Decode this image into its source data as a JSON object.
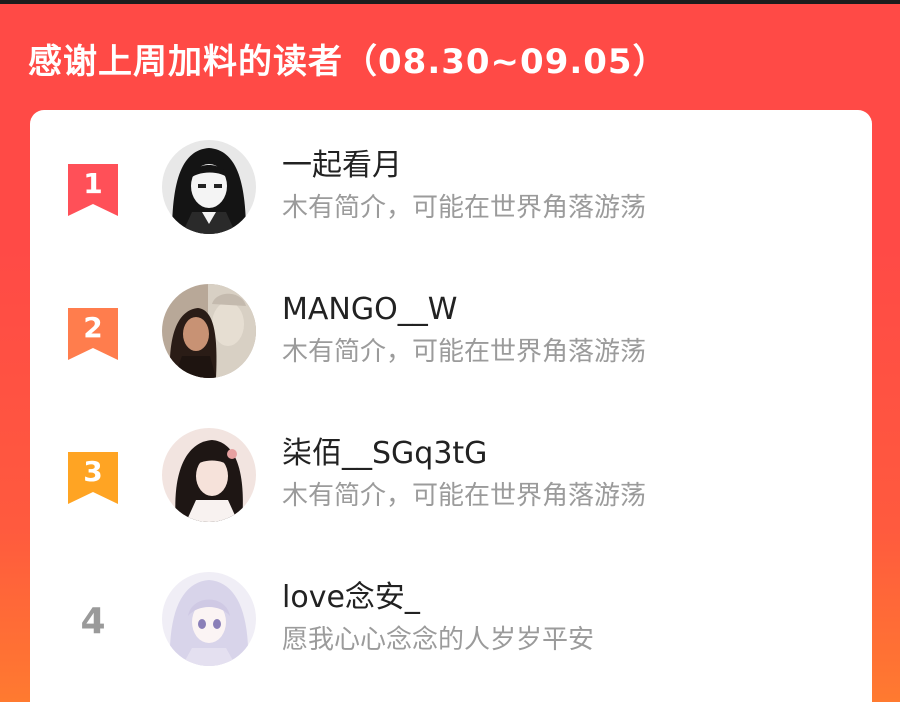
{
  "header": {
    "title": "感谢上周加料的读者（08.30~09.05）"
  },
  "readers": [
    {
      "rank": "1",
      "name": "一起看月",
      "bio": "木有简介，可能在世界角落游荡",
      "badge_color": "#ff4a55"
    },
    {
      "rank": "2",
      "name": "MANGO__W",
      "bio": "木有简介，可能在世界角落游荡",
      "badge_color": "#ff7a4a"
    },
    {
      "rank": "3",
      "name": "柒佰__SGq3tG",
      "bio": "木有简介，可能在世界角落游荡",
      "badge_color": "#ffa322"
    },
    {
      "rank": "4",
      "name": "love念安_",
      "bio": "愿我心心念念的人岁岁平安",
      "badge_color": "#9a9a9a"
    }
  ],
  "colors": {
    "background": "#ff4a46",
    "card": "#ffffff",
    "name_text": "#222222",
    "bio_text": "#9b9b9b"
  }
}
